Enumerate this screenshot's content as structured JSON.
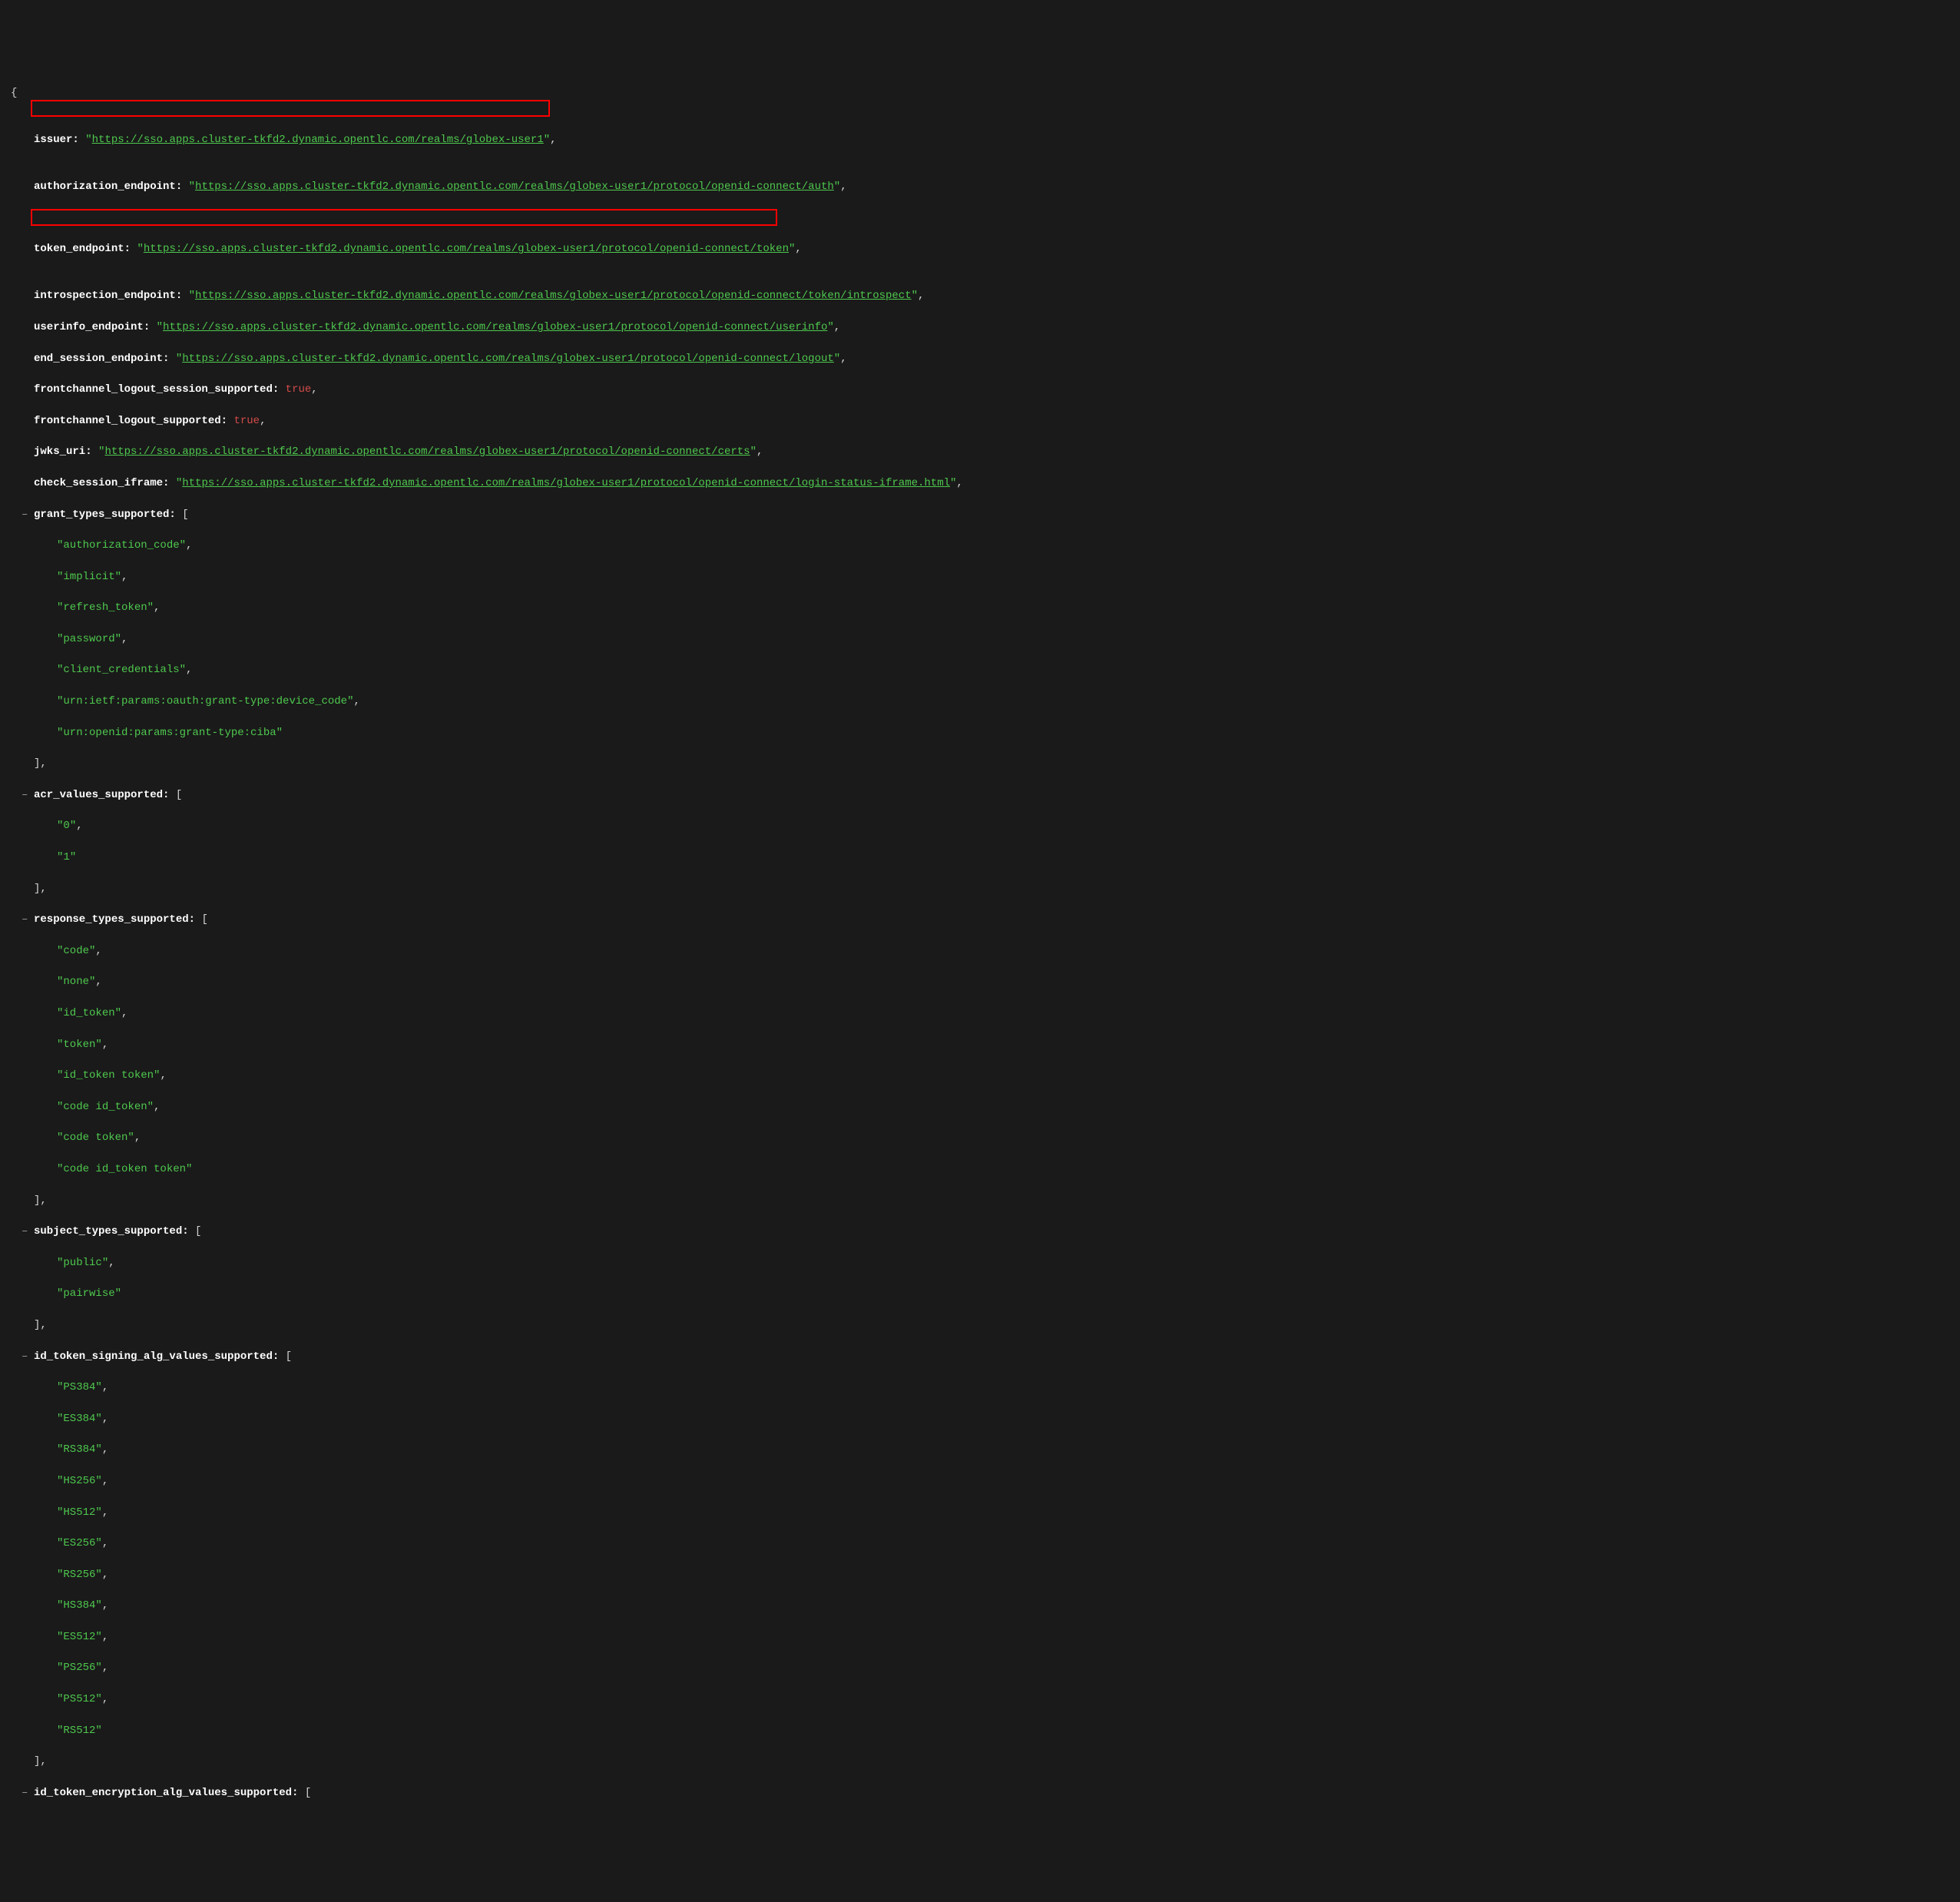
{
  "json": {
    "opening_brace": "{",
    "issuer": {
      "key": "issuer:",
      "value": "https://sso.apps.cluster-tkfd2.dynamic.opentlc.com/realms/globex-user1"
    },
    "authorization_endpoint": {
      "key": "authorization_endpoint:",
      "value": "https://sso.apps.cluster-tkfd2.dynamic.opentlc.com/realms/globex-user1/protocol/openid-connect/auth"
    },
    "token_endpoint": {
      "key": "token_endpoint:",
      "value": "https://sso.apps.cluster-tkfd2.dynamic.opentlc.com/realms/globex-user1/protocol/openid-connect/token"
    },
    "introspection_endpoint": {
      "key": "introspection_endpoint:",
      "value": "https://sso.apps.cluster-tkfd2.dynamic.opentlc.com/realms/globex-user1/protocol/openid-connect/token/introspect"
    },
    "userinfo_endpoint": {
      "key": "userinfo_endpoint:",
      "value": "https://sso.apps.cluster-tkfd2.dynamic.opentlc.com/realms/globex-user1/protocol/openid-connect/userinfo"
    },
    "end_session_endpoint": {
      "key": "end_session_endpoint:",
      "value": "https://sso.apps.cluster-tkfd2.dynamic.opentlc.com/realms/globex-user1/protocol/openid-connect/logout"
    },
    "frontchannel_logout_session_supported": {
      "key": "frontchannel_logout_session_supported:",
      "value": "true"
    },
    "frontchannel_logout_supported": {
      "key": "frontchannel_logout_supported:",
      "value": "true"
    },
    "jwks_uri": {
      "key": "jwks_uri:",
      "value": "https://sso.apps.cluster-tkfd2.dynamic.opentlc.com/realms/globex-user1/protocol/openid-connect/certs"
    },
    "check_session_iframe": {
      "key": "check_session_iframe:",
      "value": "https://sso.apps.cluster-tkfd2.dynamic.opentlc.com/realms/globex-user1/protocol/openid-connect/login-status-iframe.html"
    },
    "grant_types_supported": {
      "key": "grant_types_supported:",
      "values": [
        "authorization_code",
        "implicit",
        "refresh_token",
        "password",
        "client_credentials",
        "urn:ietf:params:oauth:grant-type:device_code",
        "urn:openid:params:grant-type:ciba"
      ]
    },
    "acr_values_supported": {
      "key": "acr_values_supported:",
      "values": [
        "0",
        "1"
      ]
    },
    "response_types_supported": {
      "key": "response_types_supported:",
      "values": [
        "code",
        "none",
        "id_token",
        "token",
        "id_token token",
        "code id_token",
        "code token",
        "code id_token token"
      ]
    },
    "subject_types_supported": {
      "key": "subject_types_supported:",
      "values": [
        "public",
        "pairwise"
      ]
    },
    "id_token_signing_alg_values_supported": {
      "key": "id_token_signing_alg_values_supported:",
      "values": [
        "PS384",
        "ES384",
        "RS384",
        "HS256",
        "HS512",
        "ES256",
        "RS256",
        "HS384",
        "ES512",
        "PS256",
        "PS512",
        "RS512"
      ]
    },
    "id_token_encryption_alg_values_supported": {
      "key": "id_token_encryption_alg_values_supported:"
    },
    "close_bracket": "],",
    "open_bracket": "["
  }
}
